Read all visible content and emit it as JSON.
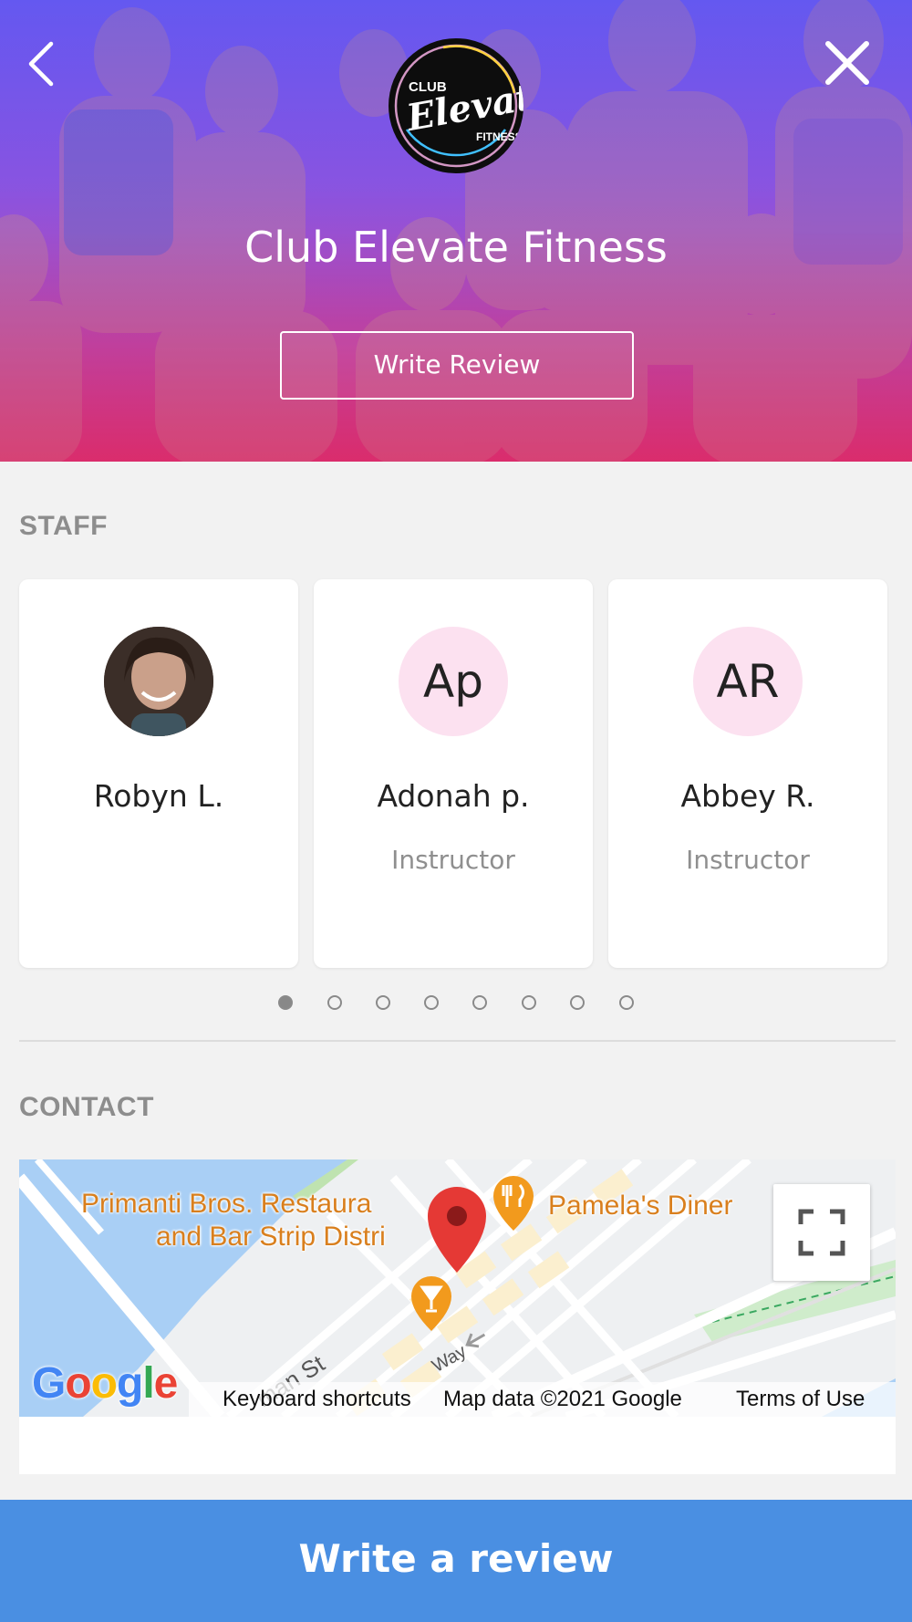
{
  "header": {
    "title": "Club Elevate Fitness",
    "logo_line1": "CLUB",
    "logo_line2": "Elevate",
    "logo_line3": "FITNESS",
    "write_review_label": "Write Review",
    "back_icon": "chevron-left",
    "close_icon": "close-x"
  },
  "staff": {
    "section_label": "STAFF",
    "members": [
      {
        "name": "Robyn L.",
        "role": "",
        "avatar_type": "photo"
      },
      {
        "name": "Adonah p.",
        "role": "Instructor",
        "initials": "Ap"
      },
      {
        "name": "Abbey R.",
        "role": "Instructor",
        "initials": "AR"
      }
    ],
    "pagination": {
      "total": 8,
      "active": 1
    }
  },
  "contact": {
    "section_label": "CONTACT",
    "map": {
      "labels": {
        "primanti_1": "Primanti Bros. Restaura",
        "primanti_2": "and Bar Strip Distri",
        "pamelas": "Pamela's Diner",
        "street_1": "man St",
        "street_2": "Way"
      },
      "google": "Google",
      "keyboard_shortcuts": "Keyboard shortcuts",
      "map_data": "Map data ©2021 Google",
      "terms": "Terms of Use"
    }
  },
  "footer": {
    "write_review_label": "Write a review"
  },
  "colors": {
    "accent": "#4a8fe2",
    "avatar_bg": "#fce1f0",
    "map_label": "#d97f1d",
    "pin": "#e53935"
  }
}
